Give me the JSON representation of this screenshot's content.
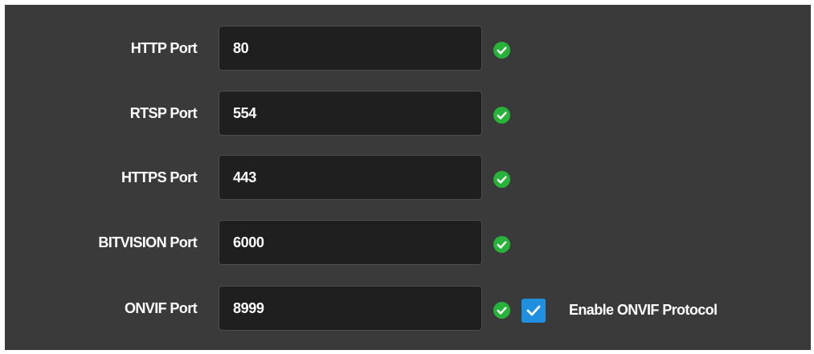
{
  "ports": [
    {
      "label": "HTTP Port",
      "value": "80",
      "status": "valid"
    },
    {
      "label": "RTSP Port",
      "value": "554",
      "status": "valid"
    },
    {
      "label": "HTTPS Port",
      "value": "443",
      "status": "valid"
    },
    {
      "label": "BITVISION Port",
      "value": "6000",
      "status": "valid"
    },
    {
      "label": "ONVIF Port",
      "value": "8999",
      "status": "valid"
    }
  ],
  "onvif": {
    "enable_label": "Enable ONVIF Protocol",
    "enabled": true
  },
  "colors": {
    "panel_bg": "#3a3a3a",
    "input_bg": "#1f1f1f",
    "valid_icon": "#27b33a",
    "checkbox_accent": "#1f8fe0"
  },
  "icons": {
    "valid": "check-circle-icon",
    "checkbox": "checkmark-icon"
  }
}
